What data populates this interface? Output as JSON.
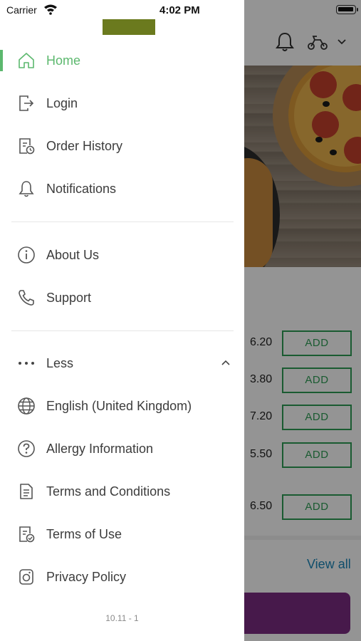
{
  "status_bar": {
    "carrier": "Carrier",
    "time": "4:02 PM"
  },
  "colors": {
    "accent_green": "#5cb86e",
    "add_green": "#2e9e55",
    "link_blue": "#1a86b8",
    "cart_purple": "#7b2b82",
    "logo_olive": "#6b7a1e"
  },
  "drawer": {
    "items": [
      {
        "label": "Home",
        "icon": "home-icon",
        "active": true
      },
      {
        "label": "Login",
        "icon": "login-icon"
      },
      {
        "label": "Order History",
        "icon": "receipt-clock-icon"
      },
      {
        "label": "Notifications",
        "icon": "bell-icon"
      },
      {
        "label": "About Us",
        "icon": "info-icon"
      },
      {
        "label": "Support",
        "icon": "phone-icon"
      },
      {
        "label": "Less",
        "icon": "more-dots-icon",
        "expanded": true
      },
      {
        "label": "English (United Kingdom)",
        "icon": "globe-icon"
      },
      {
        "label": "Allergy Information",
        "icon": "question-icon"
      },
      {
        "label": "Terms and Conditions",
        "icon": "document-icon"
      },
      {
        "label": "Terms of Use",
        "icon": "document-check-icon"
      },
      {
        "label": "Privacy Policy",
        "icon": "privacy-icon"
      }
    ],
    "version": "10.11 - 1"
  },
  "background": {
    "header_icons": [
      "bell-icon",
      "scooter-icon",
      "chevron-down-icon"
    ],
    "menu_rows": [
      {
        "price": "6.20",
        "button": "ADD"
      },
      {
        "price": "3.80",
        "button": "ADD"
      },
      {
        "price": "7.20",
        "button": "ADD"
      },
      {
        "price": "5.50",
        "button": "ADD"
      },
      {
        "price": "6.50",
        "button": "ADD"
      }
    ],
    "view_all": "View all"
  }
}
